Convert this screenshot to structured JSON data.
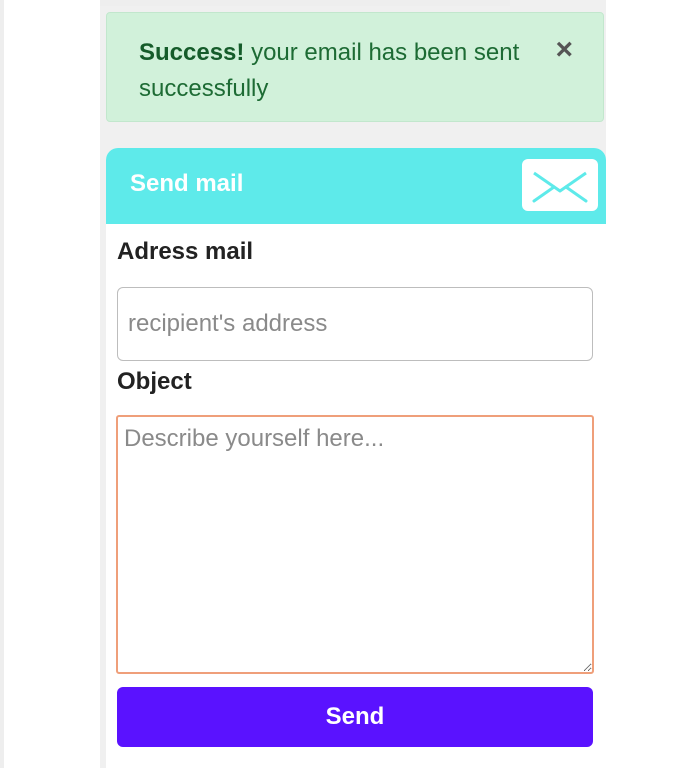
{
  "alert": {
    "title": "Success!",
    "message": " your email has been sent successfully",
    "close": "×"
  },
  "card": {
    "title": "Send mail",
    "icon": "envelope-icon",
    "header_color": "#5eeaea"
  },
  "form": {
    "address_label": "Adress mail",
    "address_placeholder": "recipient's address",
    "address_value": "",
    "object_label": "Object",
    "object_placeholder": "Describe yourself here...",
    "object_value": "",
    "send_label": "Send",
    "send_color": "#5a12ff"
  }
}
